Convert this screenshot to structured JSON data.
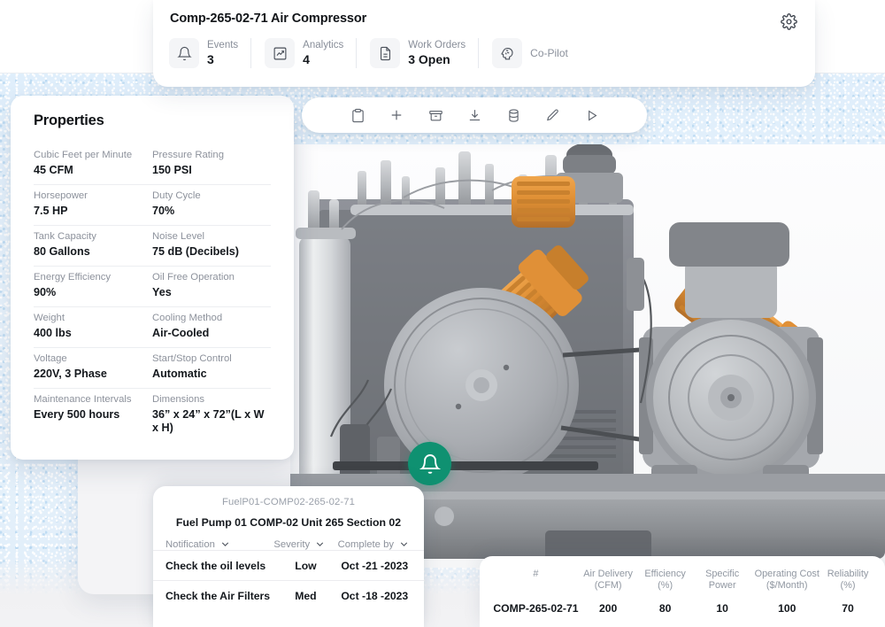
{
  "header": {
    "title": "Comp-265-02-71 Air Compressor",
    "gear_icon": "gear-icon",
    "stats": [
      {
        "icon": "bell-icon",
        "label": "Events",
        "value": "3"
      },
      {
        "icon": "chart-up-icon",
        "label": "Analytics",
        "value": "4"
      },
      {
        "icon": "document-icon",
        "label": "Work Orders",
        "value": "3 Open"
      },
      {
        "icon": "brain-head-icon",
        "label": "Co-Pilot",
        "value": ""
      }
    ]
  },
  "toolbar": {
    "buttons": [
      {
        "icon": "clipboard-icon",
        "name": "clipboard-button"
      },
      {
        "icon": "plus-icon",
        "name": "add-button"
      },
      {
        "icon": "archive-icon",
        "name": "archive-button"
      },
      {
        "icon": "download-icon",
        "name": "download-button"
      },
      {
        "icon": "database-icon",
        "name": "database-button"
      },
      {
        "icon": "pencil-icon",
        "name": "edit-button"
      },
      {
        "icon": "play-icon",
        "name": "play-button"
      }
    ]
  },
  "properties": {
    "title": "Properties",
    "rows": [
      [
        {
          "key": "Cubic Feet per Minute",
          "value": "45 CFM"
        },
        {
          "key": "Pressure Rating",
          "value": "150 PSI"
        }
      ],
      [
        {
          "key": "Horsepower",
          "value": "7.5 HP"
        },
        {
          "key": "Duty Cycle",
          "value": "70%"
        }
      ],
      [
        {
          "key": "Tank Capacity",
          "value": "80 Gallons"
        },
        {
          "key": "Noise Level",
          "value": "75 dB (Decibels)"
        }
      ],
      [
        {
          "key": "Energy Efficiency",
          "value": "90%"
        },
        {
          "key": "Oil Free Operation",
          "value": "Yes"
        }
      ],
      [
        {
          "key": "Weight",
          "value": "400 lbs"
        },
        {
          "key": "Cooling Method",
          "value": "Air-Cooled"
        }
      ],
      [
        {
          "key": "Voltage",
          "value": "220V, 3 Phase"
        },
        {
          "key": "Start/Stop Control",
          "value": "Automatic"
        }
      ],
      [
        {
          "key": "Maintenance Intervals",
          "value": "Every 500 hours"
        },
        {
          "key": "Dimensions",
          "value": "36” x 24” x 72”(L x W x H)"
        }
      ]
    ]
  },
  "fab": {
    "icon": "bell-icon",
    "color": "#0f9171"
  },
  "notifications": {
    "code": "FuelP01-COMP02-265-02-71",
    "subtitle": "Fuel Pump 01  COMP-02  Unit 265  Section 02",
    "columns": [
      {
        "label": "Notification",
        "icon": "chevron-down-icon"
      },
      {
        "label": "Severity",
        "icon": "chevron-down-icon"
      },
      {
        "label": "Complete by",
        "icon": "chevron-down-icon"
      }
    ],
    "rows": [
      {
        "task": "Check the oil levels",
        "severity": "Low",
        "complete_by": "Oct -21 -2023"
      },
      {
        "task": "Check the Air Filters",
        "severity": "Med",
        "complete_by": "Oct -18 -2023"
      }
    ]
  },
  "metrics": {
    "columns": [
      "#",
      "Air Delivery (CFM)",
      "Efficiency (%)",
      "Specific Power",
      "Operating Cost ($/Month)",
      "Reliability (%)"
    ],
    "columns_split": [
      {
        "l1": "#",
        "l2": ""
      },
      {
        "l1": "Air Delivery",
        "l2": "(CFM)"
      },
      {
        "l1": "Efficiency",
        "l2": "(%)"
      },
      {
        "l1": "Specific",
        "l2": "Power"
      },
      {
        "l1": "Operating Cost",
        "l2": "($/Month)"
      },
      {
        "l1": "Reliability",
        "l2": "(%)"
      }
    ],
    "rows": [
      {
        "id": "COMP-265-02-71",
        "air_delivery": "200",
        "efficiency": "80",
        "specific_power": "10",
        "operating_cost": "100",
        "reliability": "70"
      }
    ]
  },
  "image": {
    "alt": "air-compressor-3d-render",
    "name": "compressor-photo"
  }
}
